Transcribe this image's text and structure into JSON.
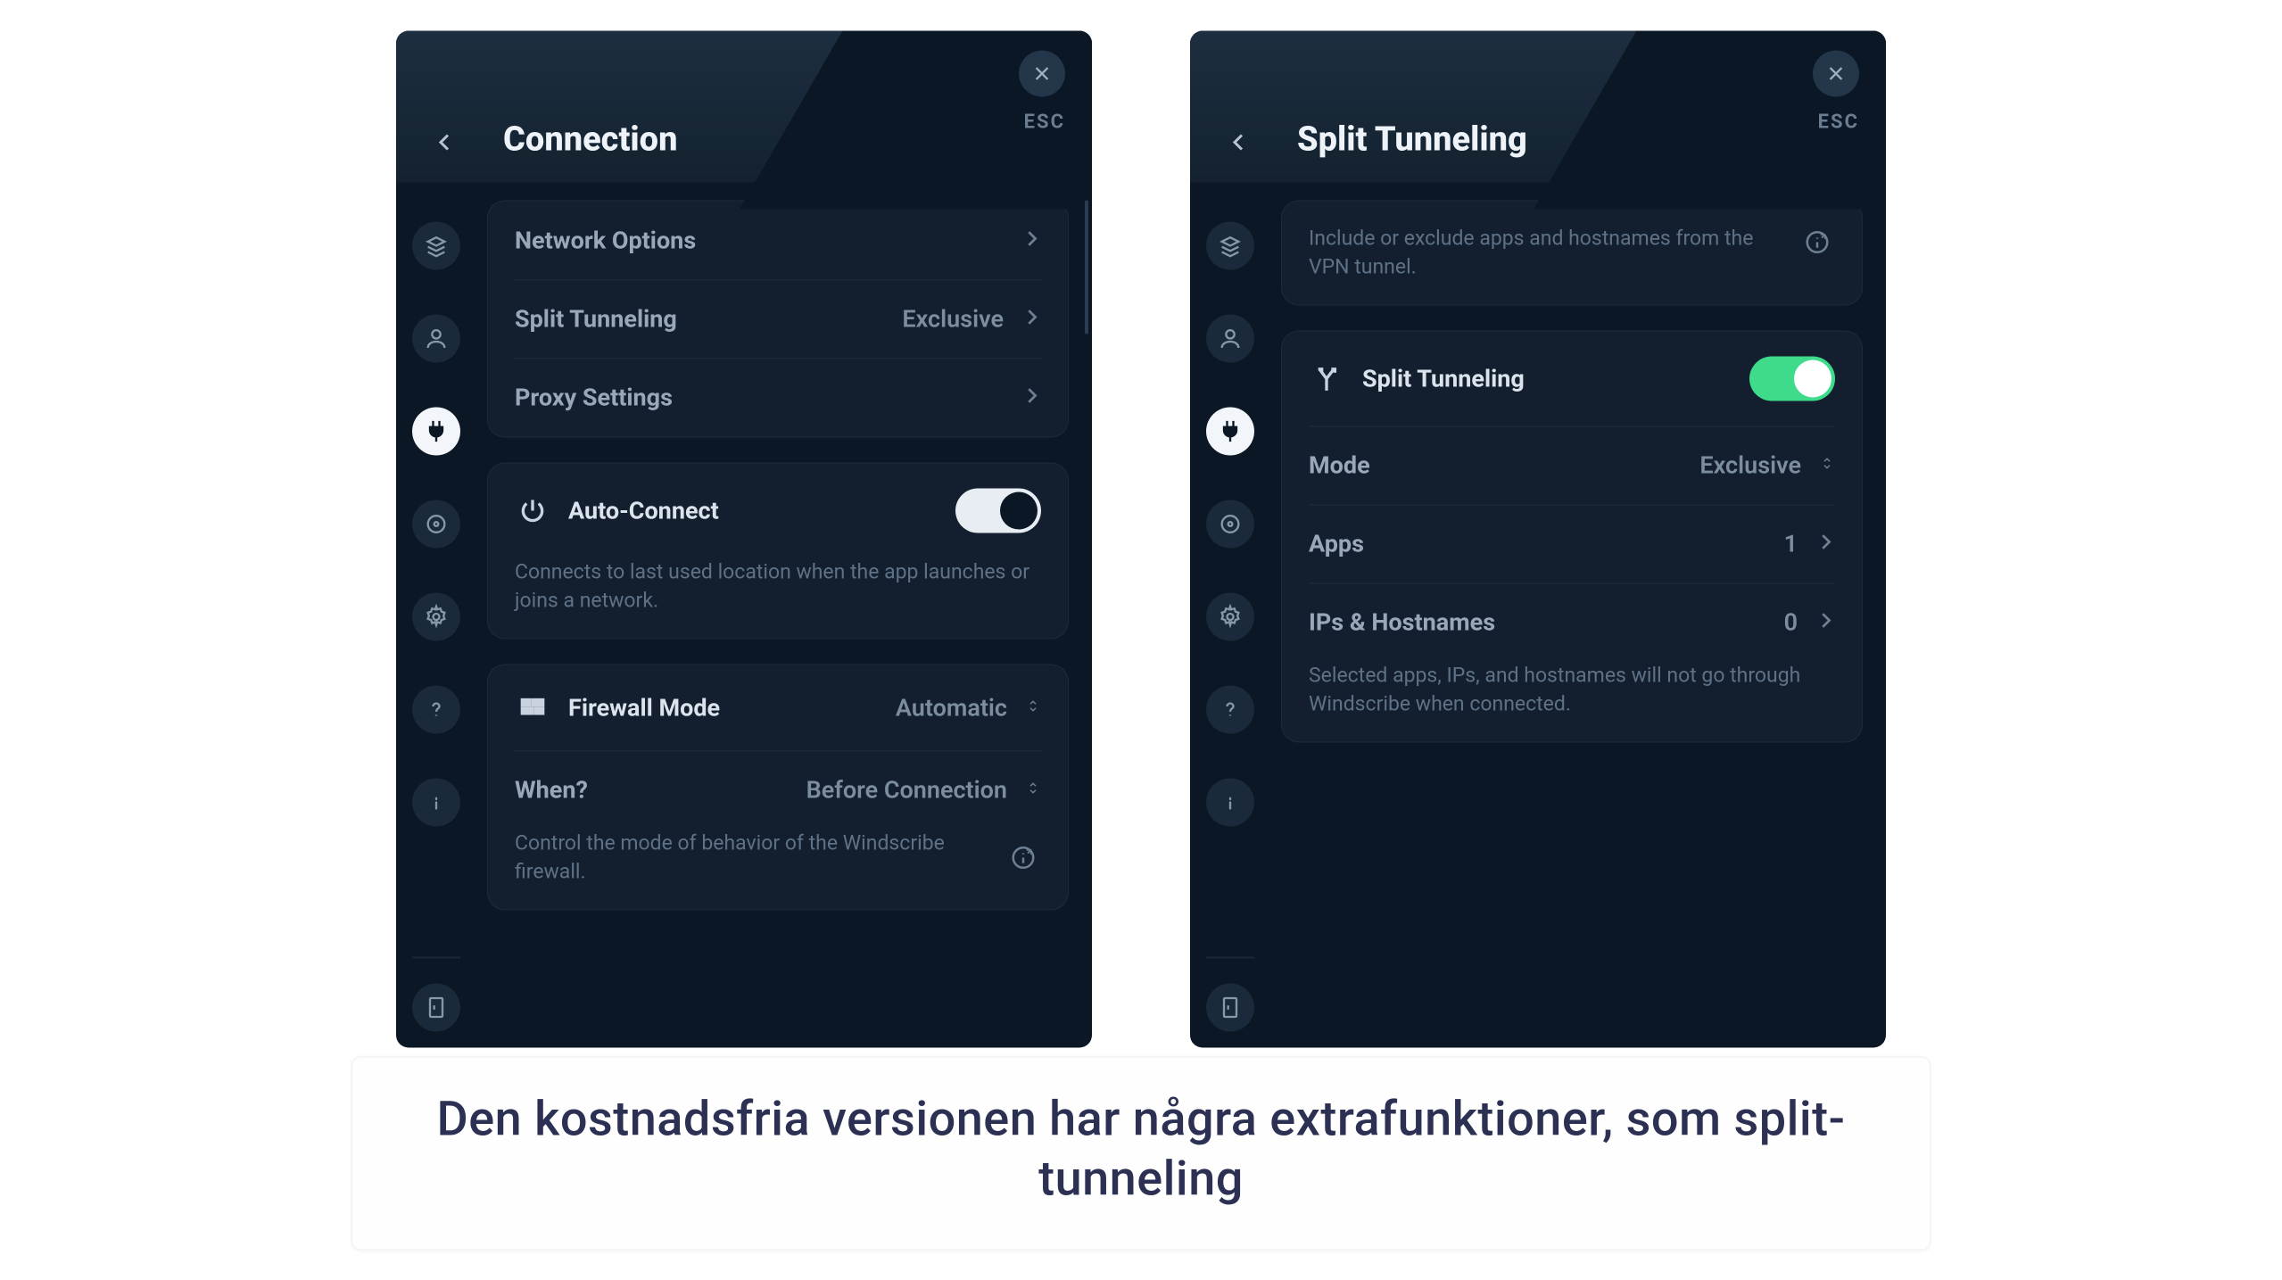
{
  "panels": {
    "left": {
      "title": "Connection",
      "esc": "ESC",
      "rows": {
        "network_options": "Network Options",
        "split_tunneling_label": "Split Tunneling",
        "split_tunneling_value": "Exclusive",
        "proxy_settings": "Proxy Settings"
      },
      "auto_connect": {
        "label": "Auto-Connect",
        "on": true,
        "desc": "Connects to last used location when the app launches or joins a network."
      },
      "firewall": {
        "mode_label": "Firewall Mode",
        "mode_value": "Automatic",
        "when_label": "When?",
        "when_value": "Before Connection",
        "desc": "Control the mode of behavior of the Windscribe firewall."
      }
    },
    "right": {
      "title": "Split Tunneling",
      "esc": "ESC",
      "intro": "Include or exclude apps and hostnames from the VPN tunnel.",
      "toggle_label": "Split Tunneling",
      "toggle_on": true,
      "mode_label": "Mode",
      "mode_value": "Exclusive",
      "apps_label": "Apps",
      "apps_count": "1",
      "ips_label": "IPs & Hostnames",
      "ips_count": "0",
      "footer_desc": "Selected apps, IPs, and hostnames will not go through Windscribe when connected."
    }
  },
  "caption": "Den kostnadsfria versionen har några extrafunktioner, som split-tunneling"
}
